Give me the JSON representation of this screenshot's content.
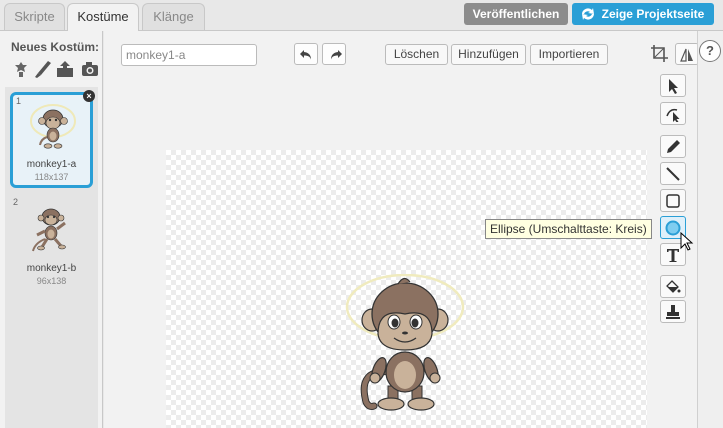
{
  "tabs": [
    {
      "label": "Skripte",
      "active": false
    },
    {
      "label": "Kostüme",
      "active": true
    },
    {
      "label": "Klänge",
      "active": false
    }
  ],
  "header": {
    "publish_label": "Veröffentlichen",
    "project_page_label": "Zeige Projektseite"
  },
  "costumes_panel": {
    "new_costume_label": "Neues Kostüm:",
    "tools": [
      "paint-from-library-icon",
      "paint-brush-icon",
      "upload-icon",
      "camera-icon"
    ],
    "items": [
      {
        "number": "1",
        "name": "monkey1-a",
        "size": "118x137",
        "selected": true
      },
      {
        "number": "2",
        "name": "monkey1-b",
        "size": "96x138",
        "selected": false
      }
    ]
  },
  "editor": {
    "costume_name_value": "monkey1-a",
    "buttons": {
      "clear": "Löschen",
      "add": "Hinzufügen",
      "import": "Importieren"
    },
    "tooltip": "Ellipse (Umschalttaste: Kreis)"
  },
  "tool_palette": [
    "select-arrow-icon",
    "reshape-icon",
    "pencil-icon",
    "line-icon",
    "rectangle-icon",
    "ellipse-icon",
    "text-icon",
    "fill-bucket-icon",
    "stamp-icon"
  ],
  "help": {
    "label": "?"
  },
  "colors": {
    "accent": "#2a9fd6",
    "publish_bg": "#8c8c8c",
    "monkey_brown": "#8b7161",
    "monkey_face": "#c9b29a"
  }
}
